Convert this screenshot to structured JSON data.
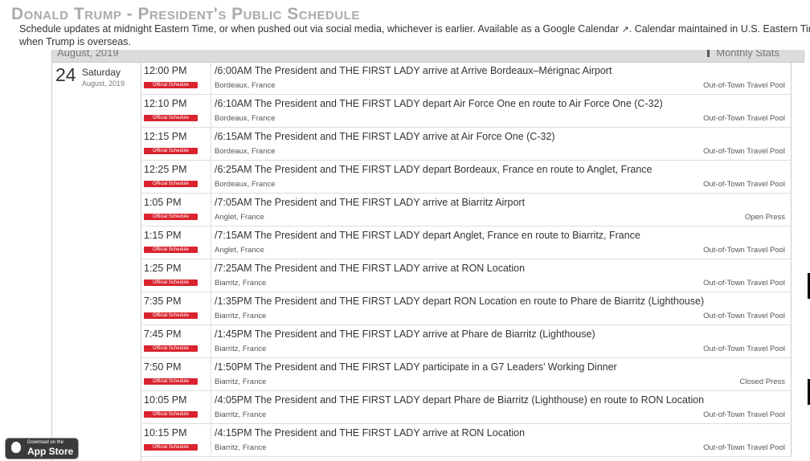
{
  "header": {
    "title": "Donald Trump - President's Public Schedule",
    "notice_line1": "Schedule updates at midnight Eastern Time, or when pushed out via social media, whichever is earlier. Available as a Google Calendar",
    "notice_line1_tail": ". Calendar maintained in U.S. Eastern Time and r",
    "notice_line2": "when Trump is overseas."
  },
  "month_bar": {
    "label": "August, 2019",
    "stats_label": "Monthly Stats"
  },
  "day": {
    "number": "24",
    "weekday": "Saturday",
    "date": "August, 2019"
  },
  "events": [
    {
      "time": "12:00 PM",
      "badge": "Official Schedule",
      "description": "/6:00AM The President and THE FIRST LADY arrive at Arrive Bordeaux–Mérignac Airport",
      "location": "Bordeaux, France",
      "coverage": "Out-of-Town Travel Pool"
    },
    {
      "time": "12:10 PM",
      "badge": "Official Schedule",
      "description": "/6:10AM The President and THE FIRST LADY depart Air Force One en route to Air Force One (C-32)",
      "location": "Bordeaux, France",
      "coverage": "Out-of-Town Travel Pool"
    },
    {
      "time": "12:15 PM",
      "badge": "Official Schedule",
      "description": "/6:15AM The President and THE FIRST LADY arrive at Air Force One (C-32)",
      "location": "Bordeaux, France",
      "coverage": "Out-of-Town Travel Pool"
    },
    {
      "time": "12:25 PM",
      "badge": "Official Schedule",
      "description": "/6:25AM The President and THE FIRST LADY depart Bordeaux, France en route to Anglet, France",
      "location": "Bordeaux, France",
      "coverage": "Out-of-Town Travel Pool"
    },
    {
      "time": "1:05 PM",
      "badge": "Official Schedule",
      "description": "/7:05AM The President and THE FIRST LADY arrive at Biarritz Airport",
      "location": "Anglet, France",
      "coverage": "Open Press"
    },
    {
      "time": "1:15 PM",
      "badge": "Official Schedule",
      "description": "/7:15AM The President and THE FIRST LADY depart Anglet, France en route to Biarritz, France",
      "location": "Anglet, France",
      "coverage": "Out-of-Town Travel Pool"
    },
    {
      "time": "1:25 PM",
      "badge": "Official Schedule",
      "description": "/7:25AM The President and THE FIRST LADY arrive at RON Location",
      "location": "Biarritz, France",
      "coverage": "Out-of-Town Travel Pool"
    },
    {
      "time": "7:35 PM",
      "badge": "Official Schedule",
      "description": "/1:35PM The President and THE FIRST LADY depart RON Location en route to Phare de Biarritz (Lighthouse)",
      "location": "Biarritz, France",
      "coverage": "Out-of-Town Travel Pool"
    },
    {
      "time": "7:45 PM",
      "badge": "Official Schedule",
      "description": "/1:45PM The President and THE FIRST LADY arrive at Phare de Biarritz (Lighthouse)",
      "location": "Biarritz, France",
      "coverage": "Out-of-Town Travel Pool"
    },
    {
      "time": "7:50 PM",
      "badge": "Official Schedule",
      "description": "/1:50PM The President and THE FIRST LADY participate in a G7 Leaders’ Working Dinner",
      "location": "Biarritz, France",
      "coverage": "Closed Press"
    },
    {
      "time": "10:05 PM",
      "badge": "Official Schedule",
      "description": "/4:05PM The President and THE FIRST LADY depart Phare de Biarritz (Lighthouse) en route to RON Location",
      "location": "Biarritz, France",
      "coverage": "Out-of-Town Travel Pool"
    },
    {
      "time": "10:15 PM",
      "badge": "Official Schedule",
      "description": "/4:15PM The President and THE FIRST LADY arrive at RON Location",
      "location": "Biarritz, France",
      "coverage": "Out-of-Town Travel Pool"
    }
  ],
  "app_store": {
    "small_text": "Download on the",
    "big_text": "App Store"
  },
  "icons": {
    "external_link": "external-link-icon",
    "stats": "bar-chart-icon",
    "apple": "apple-icon"
  },
  "colors": {
    "badge": "#d9232e",
    "title": "#aaaaaa",
    "month_bar": "#dcdcdc"
  }
}
